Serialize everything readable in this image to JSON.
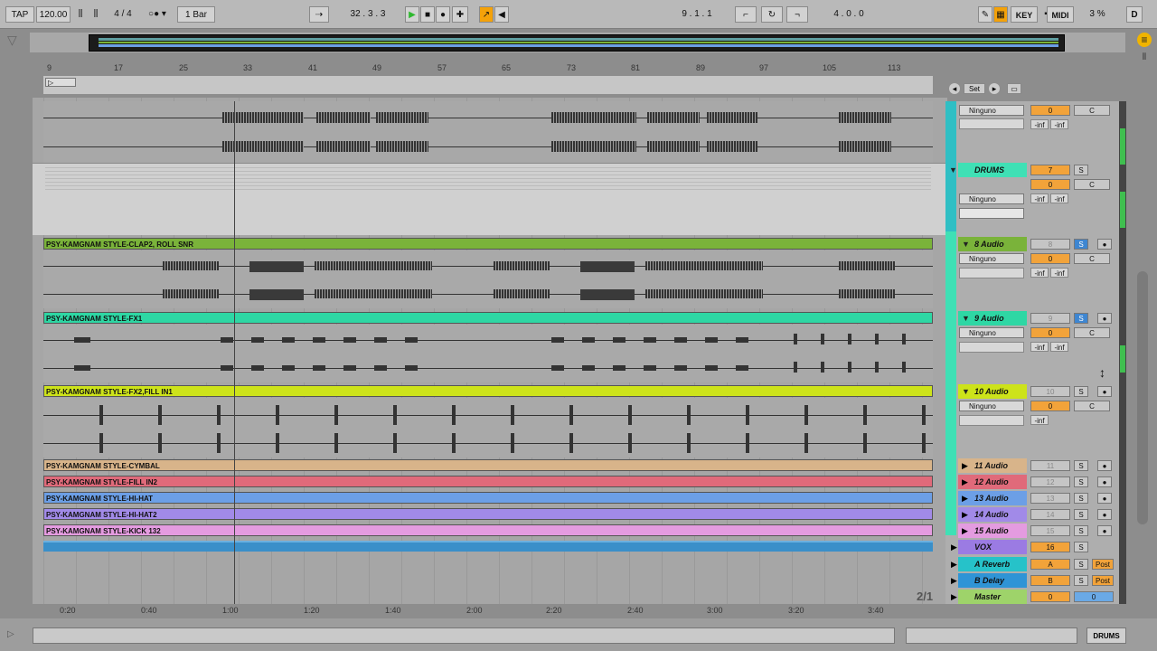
{
  "transport": {
    "tap": "TAP",
    "tempo": "120.00",
    "signature": "4 / 4",
    "quant": "1 Bar",
    "position": "32 .   3 .   3",
    "loop_start": "9 .   1 .   1",
    "loop_length": "4 .   0 .   0",
    "key": "KEY",
    "midi": "MIDI",
    "cpu": "3 %",
    "disk": "D"
  },
  "ruler": {
    "bars": [
      "9",
      "17",
      "25",
      "33",
      "41",
      "49",
      "57",
      "65",
      "73",
      "81",
      "89",
      "97",
      "105",
      "113"
    ]
  },
  "time_ruler": {
    "times": [
      "0:20",
      "0:40",
      "1:00",
      "1:20",
      "1:40",
      "2:00",
      "2:20",
      "2:40",
      "3:00",
      "3:20",
      "3:40"
    ]
  },
  "set_label": "Set",
  "grid_label": "2/1",
  "clips": [
    {
      "name": "PSY-KAMGNAM STYLE-CLAP2, ROLL SNR",
      "color": "#7ab33a"
    },
    {
      "name": "PSY-KAMGNAM STYLE-FX1",
      "color": "#2ed7a4"
    },
    {
      "name": "PSY-KAMGNAM STYLE-FX2,FILL IN1",
      "color": "#cde31a"
    },
    {
      "name": "PSY-KAMGNAM STYLE-CYMBAL",
      "color": "#d8b48a"
    },
    {
      "name": "PSY-KAMGNAM STYLE-FILL IN2",
      "color": "#e06a7a"
    },
    {
      "name": "PSY-KAMGNAM STYLE-HI-HAT",
      "color": "#6c9fe6"
    },
    {
      "name": "PSY-KAMGNAM STYLE-HI-HAT2",
      "color": "#a18ae8"
    },
    {
      "name": "PSY-KAMGNAM STYLE-KICK 132",
      "color": "#e49be0"
    }
  ],
  "mixer": {
    "input_label": "Ninguno",
    "inf": "-inf",
    "center": "C",
    "zero": "0",
    "solo": "S",
    "post": "Post",
    "tracks": [
      {
        "name": "DRUMS",
        "num": "7",
        "color": "#3fe0b5"
      },
      {
        "name": "8 Audio",
        "num": "8",
        "color": "#7ab33a"
      },
      {
        "name": "9 Audio",
        "num": "9",
        "color": "#2ed7a4"
      },
      {
        "name": "10 Audio",
        "num": "10",
        "color": "#cde31a"
      },
      {
        "name": "11 Audio",
        "num": "11",
        "color": "#d8b48a"
      },
      {
        "name": "12 Audio",
        "num": "12",
        "color": "#e06a7a"
      },
      {
        "name": "13 Audio",
        "num": "13",
        "color": "#6c9fe6"
      },
      {
        "name": "14 Audio",
        "num": "14",
        "color": "#a18ae8"
      },
      {
        "name": "15 Audio",
        "num": "15",
        "color": "#e49be0"
      },
      {
        "name": "VOX",
        "num": "16",
        "color": "#9b7be3"
      },
      {
        "name": "A Reverb",
        "num": "A",
        "color": "#26c2c9"
      },
      {
        "name": "B Delay",
        "num": "B",
        "color": "#2f94d6"
      },
      {
        "name": "Master",
        "num": "0",
        "color": "#9ed36a"
      }
    ]
  },
  "status": {
    "track": "DRUMS"
  }
}
